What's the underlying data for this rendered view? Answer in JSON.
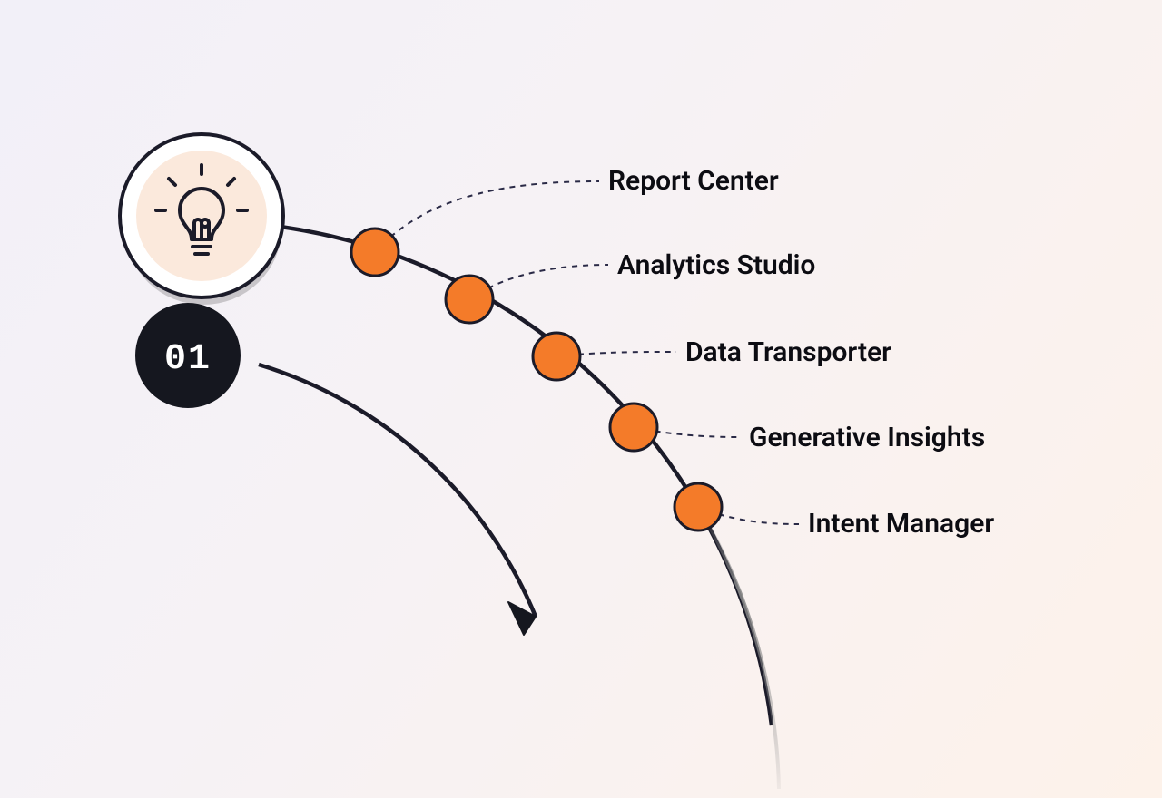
{
  "badge": {
    "number": "01"
  },
  "nodes": [
    {
      "label": "Report Center"
    },
    {
      "label": "Analytics Studio"
    },
    {
      "label": "Data Transporter"
    },
    {
      "label": "Generative Insights"
    },
    {
      "label": "Intent Manager"
    }
  ],
  "colors": {
    "node_fill": "#f47b29",
    "node_stroke": "#1b1b29",
    "badge_fill": "#15171f",
    "icon_circle_fill": "#ffffff",
    "icon_inner_fill": "#fbe9dc",
    "stroke_dark": "#1b1b29",
    "dash_stroke": "#2a2a46"
  }
}
